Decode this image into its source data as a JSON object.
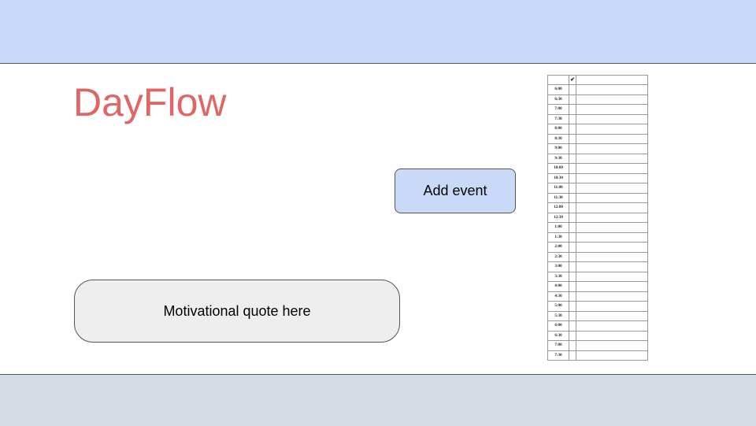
{
  "app": {
    "title": "DayFlow"
  },
  "actions": {
    "add_event_label": "Add event"
  },
  "quote": {
    "text": "Motivational quote here"
  },
  "schedule": {
    "header_check": "✔",
    "times": [
      "6:00",
      "6:30",
      "7:00",
      "7:30",
      "8:00",
      "8:30",
      "9:00",
      "9:30",
      "10:00",
      "10:30",
      "11:00",
      "11:30",
      "12:00",
      "12:30",
      "1:00",
      "1:30",
      "2:00",
      "2:30",
      "3:00",
      "3:30",
      "4:00",
      "4:30",
      "5:00",
      "5:30",
      "6:00",
      "6:30",
      "7:00",
      "7:30"
    ]
  },
  "colors": {
    "header_bg": "#c9daf8",
    "footer_bg": "#d6dce5",
    "title_color": "#e06666",
    "button_bg": "#c9daf8",
    "quote_bg": "#eeeeee"
  }
}
